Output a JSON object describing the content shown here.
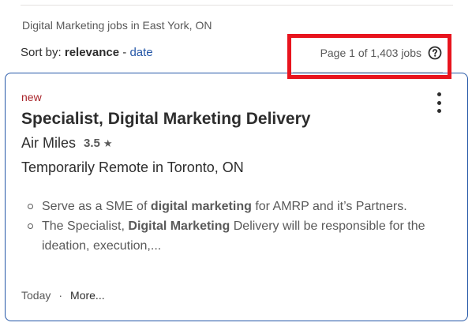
{
  "search": {
    "summary": "Digital Marketing jobs in East York, ON"
  },
  "sort": {
    "prefix": "Sort by:",
    "active": "relevance",
    "separator": "-",
    "alternate": "date"
  },
  "pagination": {
    "text": "Page 1 of 1,403 jobs",
    "help_icon": "question-circle-icon"
  },
  "highlight": {
    "color": "#e8141e"
  },
  "job": {
    "badge": "new",
    "title": "Specialist, Digital Marketing Delivery",
    "company": "Air Miles",
    "rating": "3.5",
    "rating_icon": "star-icon",
    "location": "Temporarily Remote in Toronto, ON",
    "snippet": [
      {
        "pre": "Serve as a SME of ",
        "bold": "digital marketing",
        "post": " for AMRP and it’s Partners."
      },
      {
        "pre": "The Specialist, ",
        "bold": "Digital Marketing",
        "post": " Delivery will be responsible for the ideation, execution,..."
      }
    ],
    "posted": "Today",
    "more": "More..."
  },
  "colors": {
    "accent": "#2557a7",
    "badge": "#a9252b",
    "text": "#2d2d2d",
    "muted": "#595959"
  }
}
